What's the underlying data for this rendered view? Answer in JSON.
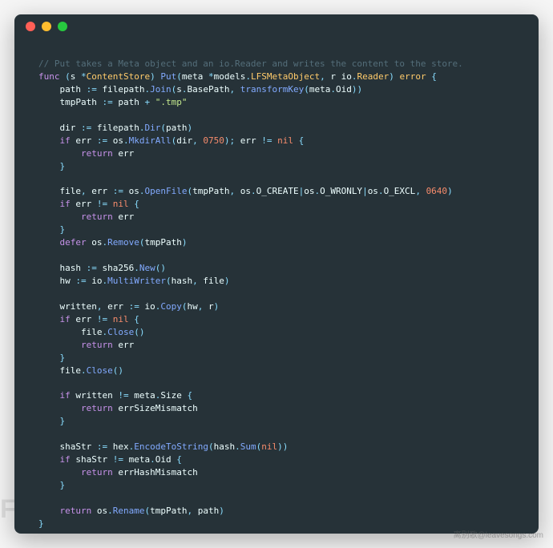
{
  "titlebar": {
    "buttons": [
      "close",
      "minimize",
      "zoom"
    ]
  },
  "code": {
    "comment": "// Put takes a Meta object and an io.Reader and writes the content to the store.",
    "tokens": {
      "func": "func",
      "s": "s",
      "star": "*",
      "ContentStore": "ContentStore",
      "Put": "Put",
      "meta": "meta",
      "models": "models",
      "LFSMetaObject": "LFSMetaObject",
      "r": "r",
      "io": "io",
      "Reader": "Reader",
      "error": "error",
      "path": "path",
      "assign": ":=",
      "filepath": "filepath",
      "Join": "Join",
      "BasePath": "BasePath",
      "transformKey": "transformKey",
      "Oid": "Oid",
      "tmpPath": "tmpPath",
      "plus": "+",
      "tmpExt": "\".tmp\"",
      "dir": "dir",
      "Dir": "Dir",
      "if": "if",
      "err": "err",
      "os": "os",
      "MkdirAll": "MkdirAll",
      "num0750": "0750",
      "neq": "!=",
      "nil": "nil",
      "return": "return",
      "file": "file",
      "OpenFile": "OpenFile",
      "O_CREATE": "O_CREATE",
      "O_WRONLY": "O_WRONLY",
      "O_EXCL": "O_EXCL",
      "num0640": "0640",
      "defer": "defer",
      "Remove": "Remove",
      "hash": "hash",
      "sha256": "sha256",
      "New": "New",
      "hw": "hw",
      "MultiWriter": "MultiWriter",
      "written": "written",
      "Copy": "Copy",
      "Close": "Close",
      "Size": "Size",
      "errSizeMismatch": "errSizeMismatch",
      "shaStr": "shaStr",
      "hex": "hex",
      "EncodeToString": "EncodeToString",
      "Sum": "Sum",
      "errHashMismatch": "errHashMismatch",
      "Rename": "Rename"
    }
  },
  "watermark": {
    "left": "FREEBUF",
    "right": "离别歌@leavesongs.com"
  }
}
